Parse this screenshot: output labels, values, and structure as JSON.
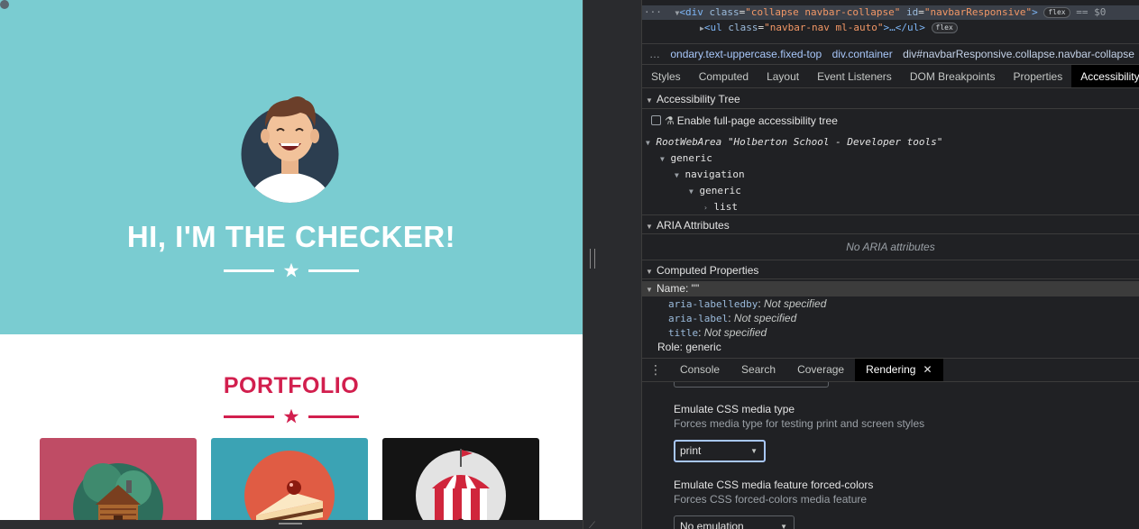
{
  "webpage": {
    "hero_title": "HI, I'M THE CHECKER!",
    "portfolio_title": "PORTFOLIO",
    "colors": {
      "hero_bg": "#7accd1",
      "accent": "#d21f4e"
    },
    "tiles": [
      "cabin-tile",
      "cake-tile",
      "circus-tile"
    ]
  },
  "devtools": {
    "elements": {
      "line1_tag_open": "<div",
      "line1_attr1": "class",
      "line1_val1": "\"collapse navbar-collapse\"",
      "line1_attr2": "id",
      "line1_val2": "\"navbarResponsive\"",
      "line1_close": ">",
      "line1_badge": "flex",
      "line1_ref": "== $0",
      "line2_tag": "<ul",
      "line2_attr": "class",
      "line2_val": "\"navbar-nav ml-auto\"",
      "line2_rest": ">…</ul>",
      "line2_badge": "flex"
    },
    "breadcrumbs": [
      "…",
      "ondary.text-uppercase.fixed-top",
      "div.container",
      "div#navbarResponsive.collapse.navbar-collapse"
    ],
    "subtabs": [
      "Styles",
      "Computed",
      "Layout",
      "Event Listeners",
      "DOM Breakpoints",
      "Properties",
      "Accessibility"
    ],
    "accessibility": {
      "tree_header": "Accessibility Tree",
      "enable_label": "Enable full-page accessibility tree",
      "root": "RootWebArea",
      "root_name": "\"Holberton School - Developer tools\"",
      "nodes": [
        "generic",
        "navigation",
        "generic",
        "list"
      ],
      "aria_header": "ARIA Attributes",
      "aria_empty": "No ARIA attributes",
      "computed_header": "Computed Properties",
      "name_row": "Name: \"\"",
      "props": [
        {
          "key": "aria-labelledby",
          "value": "Not specified"
        },
        {
          "key": "aria-label",
          "value": "Not specified"
        },
        {
          "key": "title",
          "value": "Not specified"
        }
      ],
      "role": "Role: generic"
    },
    "drawer": {
      "tabs": [
        "Console",
        "Search",
        "Coverage",
        "Rendering"
      ],
      "active_tab": "Rendering",
      "media_type_title": "Emulate CSS media type",
      "media_type_desc": "Forces media type for testing print and screen styles",
      "media_type_value": "print",
      "forced_colors_title": "Emulate CSS media feature forced-colors",
      "forced_colors_desc": "Forces CSS forced-colors media feature",
      "forced_colors_value": "No emulation"
    }
  }
}
